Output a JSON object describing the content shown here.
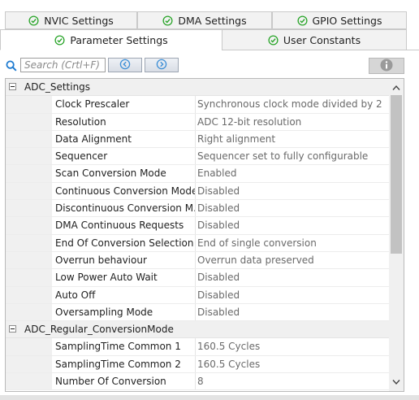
{
  "tabs": {
    "row1": [
      {
        "label": "NVIC Settings",
        "icon": "check-circle-icon"
      },
      {
        "label": "DMA Settings",
        "icon": "check-circle-icon"
      },
      {
        "label": "GPIO Settings",
        "icon": "check-circle-icon"
      }
    ],
    "row2": [
      {
        "label": "Parameter Settings",
        "icon": "check-circle-icon",
        "active": true
      },
      {
        "label": "User Constants",
        "icon": "check-circle-icon"
      }
    ]
  },
  "colors": {
    "check": "#2aa52a",
    "search": "#1e7bd1",
    "nav": "#3d8fd6",
    "info": "#9a9a9a"
  },
  "toolbar": {
    "search_placeholder": "Search (Crtl+F)",
    "prev_icon": "chevron-left-circle-icon",
    "next_icon": "chevron-right-circle-icon",
    "info_icon": "info-icon"
  },
  "groups": [
    {
      "label": "ADC_Settings",
      "props": [
        {
          "name": "Clock Prescaler",
          "value": "Synchronous clock mode divided by 2"
        },
        {
          "name": "Resolution",
          "value": "ADC 12-bit resolution"
        },
        {
          "name": "Data Alignment",
          "value": "Right alignment"
        },
        {
          "name": "Sequencer",
          "value": "Sequencer set to fully configurable"
        },
        {
          "name": "Scan Conversion Mode",
          "value": "Enabled"
        },
        {
          "name": "Continuous Conversion Mode",
          "value": "Disabled"
        },
        {
          "name": "Discontinuous Conversion M...",
          "value": "Disabled"
        },
        {
          "name": "DMA Continuous Requests",
          "value": "Disabled"
        },
        {
          "name": "End Of Conversion Selection",
          "value": "End of single conversion"
        },
        {
          "name": "Overrun behaviour",
          "value": "Overrun data preserved"
        },
        {
          "name": "Low Power Auto Wait",
          "value": "Disabled"
        },
        {
          "name": "Auto Off",
          "value": "Disabled"
        },
        {
          "name": "Oversampling Mode",
          "value": "Disabled"
        }
      ]
    },
    {
      "label": "ADC_Regular_ConversionMode",
      "props": [
        {
          "name": "SamplingTime Common 1",
          "value": "160.5 Cycles"
        },
        {
          "name": "SamplingTime Common 2",
          "value": "160.5 Cycles"
        },
        {
          "name": "Number Of Conversion",
          "value": "8"
        }
      ]
    }
  ],
  "scrollbar": {
    "position_fraction": 0.0,
    "visible_fraction": 0.55
  }
}
